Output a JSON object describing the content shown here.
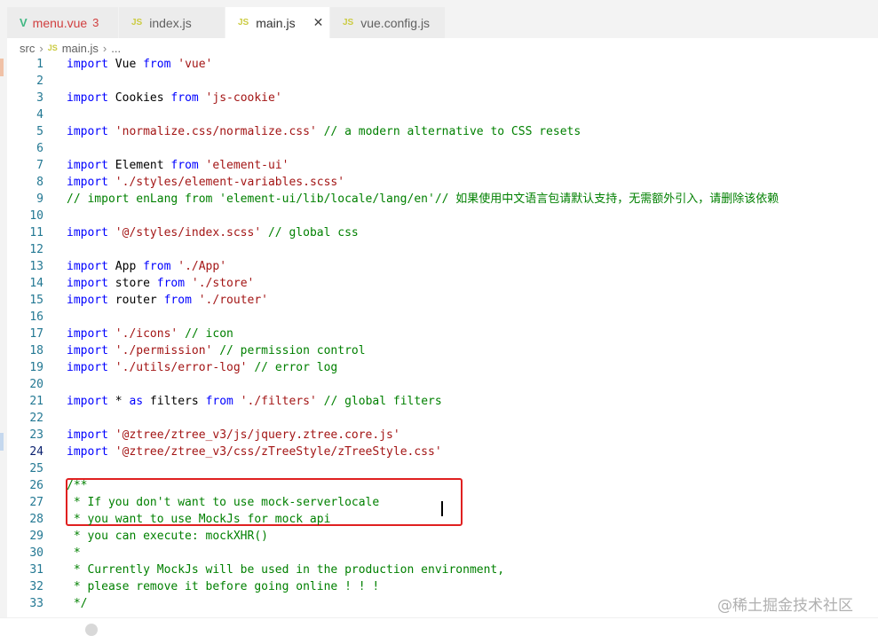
{
  "tabs": [
    {
      "icon": "vue-icon",
      "label": "menu.vue",
      "badge": "3",
      "label_color": "#d13f3f"
    },
    {
      "icon": "js-icon",
      "label": "index.js"
    },
    {
      "icon": "js-icon",
      "label": "main.js",
      "active": true
    },
    {
      "icon": "js-icon",
      "label": "vue.config.js"
    }
  ],
  "breadcrumb": {
    "folder": "src",
    "file": "main.js",
    "more": "..."
  },
  "icons": {
    "js": "JS",
    "vue": "V",
    "close": "✕",
    "chevron": "›"
  },
  "editor": {
    "lines": [
      {
        "n": "1",
        "t": [
          [
            "kw",
            "import"
          ],
          [
            "",
            "Vue "
          ],
          [
            "kw",
            "from"
          ],
          [
            "str",
            " 'vue'"
          ]
        ]
      },
      {
        "n": "2",
        "t": []
      },
      {
        "n": "3",
        "t": [
          [
            "kw",
            "import"
          ],
          [
            "",
            "Cookies "
          ],
          [
            "kw",
            "from"
          ],
          [
            "str",
            " 'js-cookie'"
          ]
        ]
      },
      {
        "n": "4",
        "t": []
      },
      {
        "n": "5",
        "t": [
          [
            "kw",
            "import"
          ],
          [
            "str",
            " 'normalize.css/normalize.css'"
          ],
          [
            "cm",
            " // a modern alternative to CSS resets"
          ]
        ]
      },
      {
        "n": "6",
        "t": []
      },
      {
        "n": "7",
        "t": [
          [
            "kw",
            "import"
          ],
          [
            "",
            "Element "
          ],
          [
            "kw",
            "from"
          ],
          [
            "str",
            " 'element-ui'"
          ]
        ]
      },
      {
        "n": "8",
        "t": [
          [
            "kw",
            "import"
          ],
          [
            "str",
            " './styles/element-variables.scss'"
          ]
        ]
      },
      {
        "n": "9",
        "t": [
          [
            "cm",
            "// import enLang from 'element-ui/lib/locale/lang/en'// 如果使用中文语言包请默认支持，无需额外引入，请删除该依赖"
          ]
        ]
      },
      {
        "n": "10",
        "t": []
      },
      {
        "n": "11",
        "t": [
          [
            "kw",
            "import"
          ],
          [
            "str",
            " '@/styles/index.scss'"
          ],
          [
            "cm",
            " // global css"
          ]
        ]
      },
      {
        "n": "12",
        "t": []
      },
      {
        "n": "13",
        "t": [
          [
            "kw",
            "import"
          ],
          [
            "",
            "App "
          ],
          [
            "kw",
            "from"
          ],
          [
            "str",
            " './App'"
          ]
        ]
      },
      {
        "n": "14",
        "t": [
          [
            "kw",
            "import"
          ],
          [
            "",
            "store "
          ],
          [
            "kw",
            "from"
          ],
          [
            "str",
            " './store'"
          ]
        ]
      },
      {
        "n": "15",
        "t": [
          [
            "kw",
            "import"
          ],
          [
            "",
            "router "
          ],
          [
            "kw",
            "from"
          ],
          [
            "str",
            " './router'"
          ]
        ]
      },
      {
        "n": "16",
        "t": []
      },
      {
        "n": "17",
        "t": [
          [
            "kw",
            "import"
          ],
          [
            "str",
            " './icons'"
          ],
          [
            "cm",
            " // icon"
          ]
        ]
      },
      {
        "n": "18",
        "t": [
          [
            "kw",
            "import"
          ],
          [
            "str",
            " './permission'"
          ],
          [
            "cm",
            " // permission control"
          ]
        ]
      },
      {
        "n": "19",
        "t": [
          [
            "kw",
            "import"
          ],
          [
            "str",
            " './utils/error-log'"
          ],
          [
            "cm",
            " // error log"
          ]
        ]
      },
      {
        "n": "20",
        "t": []
      },
      {
        "n": "21",
        "t": [
          [
            "kw",
            "import"
          ],
          [
            "",
            " * "
          ],
          [
            "kw",
            "as"
          ],
          [
            "",
            " filters "
          ],
          [
            "kw",
            "from"
          ],
          [
            "str",
            " './filters'"
          ],
          [
            "cm",
            " // global filters"
          ]
        ]
      },
      {
        "n": "22",
        "t": []
      },
      {
        "n": "23",
        "t": [
          [
            "kw",
            "import"
          ],
          [
            "str",
            " '@ztree/ztree_v3/js/jquery.ztree.core.js'"
          ]
        ]
      },
      {
        "n": "24",
        "t": [
          [
            "kw",
            "import"
          ],
          [
            "str",
            " '@ztree/ztree_v3/css/zTreeStyle/zTreeStyle.css'"
          ]
        ]
      },
      {
        "n": "25",
        "t": []
      },
      {
        "n": "26",
        "t": [
          [
            "cm",
            "/**"
          ]
        ]
      },
      {
        "n": "27",
        "t": [
          [
            "cm",
            " * If you don't want to use mock-serverlocale"
          ]
        ]
      },
      {
        "n": "28",
        "t": [
          [
            "cm",
            " * you want to use MockJs for mock api"
          ]
        ]
      },
      {
        "n": "29",
        "t": [
          [
            "cm",
            " * you can execute: mockXHR()"
          ]
        ]
      },
      {
        "n": "30",
        "t": [
          [
            "cm",
            " *"
          ]
        ]
      },
      {
        "n": "31",
        "t": [
          [
            "cm",
            " * Currently MockJs will be used in the production environment,"
          ]
        ]
      },
      {
        "n": "32",
        "t": [
          [
            "cm",
            " * please remove it before going online ! ! !"
          ]
        ]
      },
      {
        "n": "33",
        "t": [
          [
            "cm",
            " */"
          ]
        ]
      }
    ],
    "current_line": "24"
  },
  "watermark": "@稀土掘金技术社区",
  "colors": {
    "keyword": "#0000ff",
    "string": "#a31515",
    "comment": "#008000",
    "line_number": "#237893",
    "highlight_box": "#e02020"
  }
}
